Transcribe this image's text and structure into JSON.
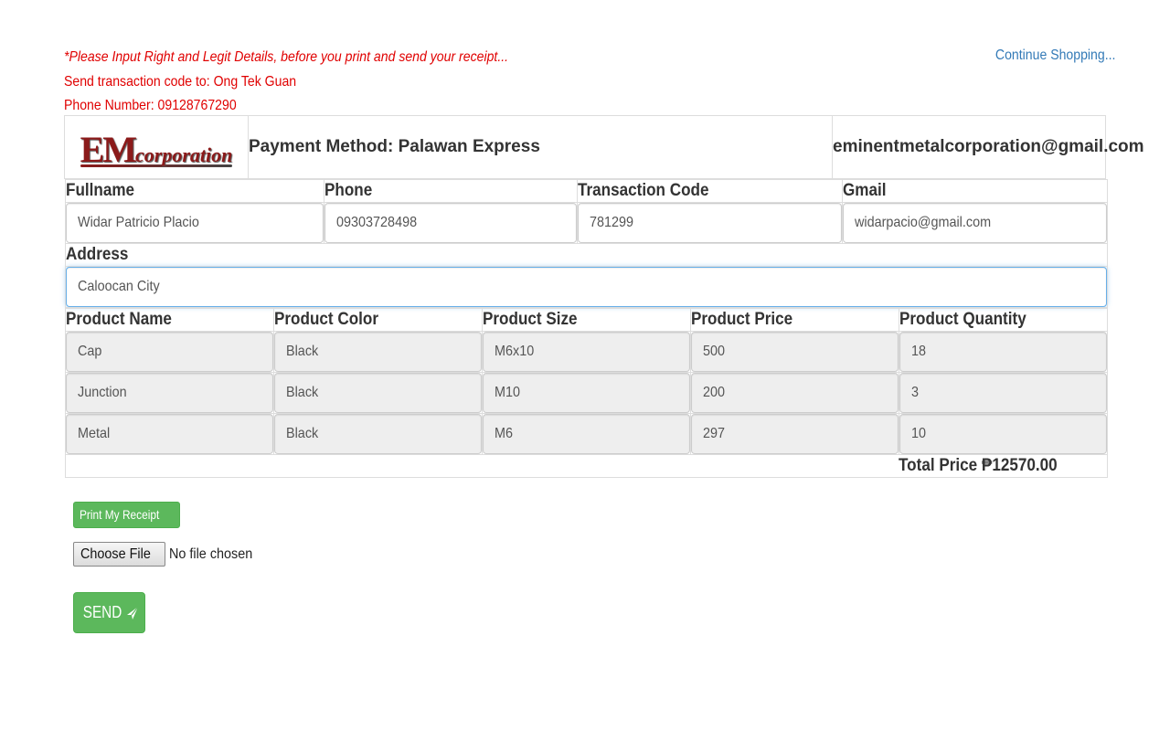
{
  "notice": {
    "line1": "*Please Input Right and Legit Details, before you print and send your receipt...",
    "line2": "Send transaction code to: Ong Tek Guan",
    "line3": "Phone Number: 09128767290"
  },
  "continue_label": "Continue Shopping...",
  "header": {
    "logo_em": "EM",
    "logo_corp": "corporation",
    "payment_method": "Payment Method: Palawan Express",
    "email": "eminentmetalcorporation@gmail.com"
  },
  "customer": {
    "labels": [
      "Fullname",
      "Phone",
      "Transaction Code",
      "Gmail"
    ],
    "values": [
      "Widar Patricio Placio",
      "09303728498",
      "781299",
      "widarpacio@gmail.com"
    ],
    "address_label": "Address",
    "address_value": "Caloocan City"
  },
  "products": {
    "headers": [
      "Product Name",
      "Product Color",
      "Product Size",
      "Product Price",
      "Product Quantity"
    ],
    "rows": [
      [
        "Cap",
        "Black",
        "M6x10",
        "500",
        "18"
      ],
      [
        "Junction",
        "Black",
        "M10",
        "200",
        "3"
      ],
      [
        "Metal",
        "Black",
        "M6",
        "297",
        "10"
      ]
    ]
  },
  "total": "Total Price ₱12570.00",
  "actions": {
    "print_label": "Print My Receipt",
    "choose_file_label": "Choose File",
    "file_status": "No file chosen",
    "send_label": "SEND",
    "send_icon": "paper-plane-icon"
  },
  "colors": {
    "notice": "#e00000",
    "link": "#337ab7",
    "button_green": "#5cb85c",
    "logo_red": "#8b1a1a"
  }
}
